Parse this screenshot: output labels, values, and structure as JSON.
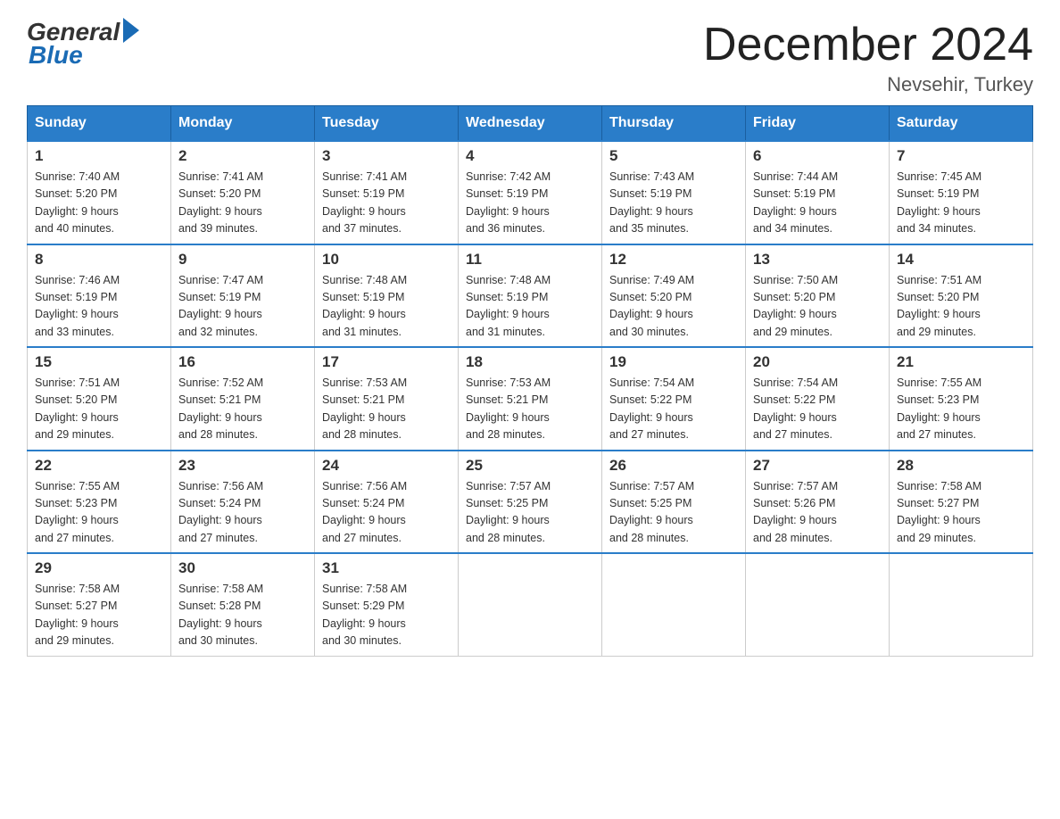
{
  "logo": {
    "general": "General",
    "blue": "Blue"
  },
  "title": "December 2024",
  "location": "Nevsehir, Turkey",
  "days_of_week": [
    "Sunday",
    "Monday",
    "Tuesday",
    "Wednesday",
    "Thursday",
    "Friday",
    "Saturday"
  ],
  "weeks": [
    [
      {
        "day": "1",
        "sunrise": "7:40 AM",
        "sunset": "5:20 PM",
        "daylight": "9 hours and 40 minutes."
      },
      {
        "day": "2",
        "sunrise": "7:41 AM",
        "sunset": "5:20 PM",
        "daylight": "9 hours and 39 minutes."
      },
      {
        "day": "3",
        "sunrise": "7:41 AM",
        "sunset": "5:19 PM",
        "daylight": "9 hours and 37 minutes."
      },
      {
        "day": "4",
        "sunrise": "7:42 AM",
        "sunset": "5:19 PM",
        "daylight": "9 hours and 36 minutes."
      },
      {
        "day": "5",
        "sunrise": "7:43 AM",
        "sunset": "5:19 PM",
        "daylight": "9 hours and 35 minutes."
      },
      {
        "day": "6",
        "sunrise": "7:44 AM",
        "sunset": "5:19 PM",
        "daylight": "9 hours and 34 minutes."
      },
      {
        "day": "7",
        "sunrise": "7:45 AM",
        "sunset": "5:19 PM",
        "daylight": "9 hours and 34 minutes."
      }
    ],
    [
      {
        "day": "8",
        "sunrise": "7:46 AM",
        "sunset": "5:19 PM",
        "daylight": "9 hours and 33 minutes."
      },
      {
        "day": "9",
        "sunrise": "7:47 AM",
        "sunset": "5:19 PM",
        "daylight": "9 hours and 32 minutes."
      },
      {
        "day": "10",
        "sunrise": "7:48 AM",
        "sunset": "5:19 PM",
        "daylight": "9 hours and 31 minutes."
      },
      {
        "day": "11",
        "sunrise": "7:48 AM",
        "sunset": "5:19 PM",
        "daylight": "9 hours and 31 minutes."
      },
      {
        "day": "12",
        "sunrise": "7:49 AM",
        "sunset": "5:20 PM",
        "daylight": "9 hours and 30 minutes."
      },
      {
        "day": "13",
        "sunrise": "7:50 AM",
        "sunset": "5:20 PM",
        "daylight": "9 hours and 29 minutes."
      },
      {
        "day": "14",
        "sunrise": "7:51 AM",
        "sunset": "5:20 PM",
        "daylight": "9 hours and 29 minutes."
      }
    ],
    [
      {
        "day": "15",
        "sunrise": "7:51 AM",
        "sunset": "5:20 PM",
        "daylight": "9 hours and 29 minutes."
      },
      {
        "day": "16",
        "sunrise": "7:52 AM",
        "sunset": "5:21 PM",
        "daylight": "9 hours and 28 minutes."
      },
      {
        "day": "17",
        "sunrise": "7:53 AM",
        "sunset": "5:21 PM",
        "daylight": "9 hours and 28 minutes."
      },
      {
        "day": "18",
        "sunrise": "7:53 AM",
        "sunset": "5:21 PM",
        "daylight": "9 hours and 28 minutes."
      },
      {
        "day": "19",
        "sunrise": "7:54 AM",
        "sunset": "5:22 PM",
        "daylight": "9 hours and 27 minutes."
      },
      {
        "day": "20",
        "sunrise": "7:54 AM",
        "sunset": "5:22 PM",
        "daylight": "9 hours and 27 minutes."
      },
      {
        "day": "21",
        "sunrise": "7:55 AM",
        "sunset": "5:23 PM",
        "daylight": "9 hours and 27 minutes."
      }
    ],
    [
      {
        "day": "22",
        "sunrise": "7:55 AM",
        "sunset": "5:23 PM",
        "daylight": "9 hours and 27 minutes."
      },
      {
        "day": "23",
        "sunrise": "7:56 AM",
        "sunset": "5:24 PM",
        "daylight": "9 hours and 27 minutes."
      },
      {
        "day": "24",
        "sunrise": "7:56 AM",
        "sunset": "5:24 PM",
        "daylight": "9 hours and 27 minutes."
      },
      {
        "day": "25",
        "sunrise": "7:57 AM",
        "sunset": "5:25 PM",
        "daylight": "9 hours and 28 minutes."
      },
      {
        "day": "26",
        "sunrise": "7:57 AM",
        "sunset": "5:25 PM",
        "daylight": "9 hours and 28 minutes."
      },
      {
        "day": "27",
        "sunrise": "7:57 AM",
        "sunset": "5:26 PM",
        "daylight": "9 hours and 28 minutes."
      },
      {
        "day": "28",
        "sunrise": "7:58 AM",
        "sunset": "5:27 PM",
        "daylight": "9 hours and 29 minutes."
      }
    ],
    [
      {
        "day": "29",
        "sunrise": "7:58 AM",
        "sunset": "5:27 PM",
        "daylight": "9 hours and 29 minutes."
      },
      {
        "day": "30",
        "sunrise": "7:58 AM",
        "sunset": "5:28 PM",
        "daylight": "9 hours and 30 minutes."
      },
      {
        "day": "31",
        "sunrise": "7:58 AM",
        "sunset": "5:29 PM",
        "daylight": "9 hours and 30 minutes."
      },
      null,
      null,
      null,
      null
    ]
  ],
  "labels": {
    "sunrise_prefix": "Sunrise: ",
    "sunset_prefix": "Sunset: ",
    "daylight_prefix": "Daylight: "
  }
}
